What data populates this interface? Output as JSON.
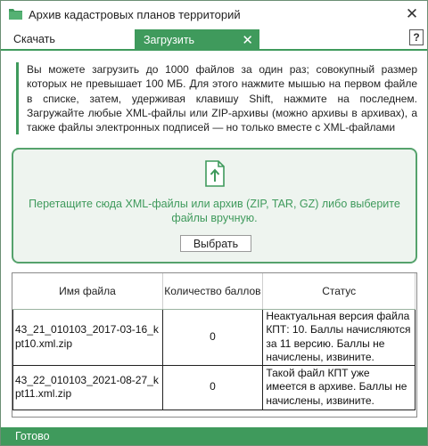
{
  "window": {
    "title": "Архив кадастровых планов территорий",
    "title_icon": "green-folder-icon",
    "close_icon": "close-icon"
  },
  "tabs": [
    {
      "label": "Скачать",
      "active": false
    },
    {
      "label": "Загрузить",
      "active": true
    }
  ],
  "help_label": "?",
  "info_text": "Вы можете загрузить до 1000 файлов за один раз; совокупный размер которых не превышает 100 МБ. Для этого нажмите мышью на первом файле в списке, затем, удерживая клавишу Shift, нажмите на последнем. Загружайте любые XML-файлы или ZIP-архивы (можно архивы в архивах), а также файлы электронных подписей — но только вместе с XML-файлами",
  "dropzone": {
    "icon": "file-upload-icon",
    "text": "Перетащите сюда XML-файлы или архив (ZIP, TAR, GZ) либо выберите файлы вручную.",
    "button_label": "Выбрать"
  },
  "table": {
    "columns": [
      "Имя файла",
      "Количество баллов",
      "Статус"
    ],
    "rows": [
      {
        "name": "43_21_010103_2017-03-16_kpt10.xml.zip",
        "count": "0",
        "status": "Неактуальная версия файла КПТ: 10. Баллы начисляются за 11 версию. Баллы не начислены, извините."
      },
      {
        "name": "43_22_010103_2021-08-27_kpt11.xml.zip",
        "count": "0",
        "status": "Такой файл КПТ уже имеется в архиве. Баллы не начислены, извините."
      }
    ]
  },
  "status_bar": "Готово",
  "colors": {
    "accent": "#3f9a5c",
    "dropzone_bg": "#eef4ef"
  }
}
